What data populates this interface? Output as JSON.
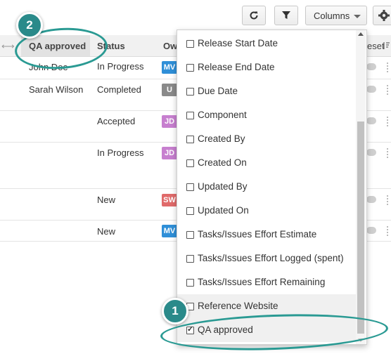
{
  "toolbar": {
    "columns_label": "Columns"
  },
  "grid": {
    "headers": {
      "qa": "QA approved",
      "status": "Status",
      "owner": "Ow",
      "preset": "eset"
    },
    "rows": [
      {
        "name": "John Doe",
        "status": "In Progress",
        "badge": "MV",
        "badge_color": "#2f8fd8"
      },
      {
        "name": "Sarah Wilson",
        "status": "Completed",
        "badge": "U",
        "badge_color": "#8a8a8a"
      },
      {
        "name": "",
        "status": "Accepted",
        "badge": "JD",
        "badge_color": "#c77fcf"
      },
      {
        "name": "",
        "status": "In Progress",
        "badge": "JD",
        "badge_color": "#c77fcf"
      },
      {
        "name": "",
        "status": "New",
        "badge": "SW",
        "badge_color": "#e06a6a"
      },
      {
        "name": "",
        "status": "New",
        "badge": "MV",
        "badge_color": "#2f8fd8"
      }
    ]
  },
  "columns_menu": {
    "options": [
      {
        "label": "Release Start Date",
        "checked": false
      },
      {
        "label": "Release End Date",
        "checked": false
      },
      {
        "label": "Due Date",
        "checked": false
      },
      {
        "label": "Component",
        "checked": false
      },
      {
        "label": "Created By",
        "checked": false
      },
      {
        "label": "Created On",
        "checked": false
      },
      {
        "label": "Updated By",
        "checked": false
      },
      {
        "label": "Updated On",
        "checked": false
      },
      {
        "label": "Tasks/Issues Effort Estimate",
        "checked": false
      },
      {
        "label": "Tasks/Issues Effort Logged (spent)",
        "checked": false
      },
      {
        "label": "Tasks/Issues Effort Remaining",
        "checked": false
      },
      {
        "label": "Reference Website",
        "checked": false
      },
      {
        "label": "QA approved",
        "checked": true
      }
    ]
  },
  "callouts": {
    "one": "1",
    "two": "2"
  },
  "colors": {
    "accent": "#2a8a8a"
  }
}
